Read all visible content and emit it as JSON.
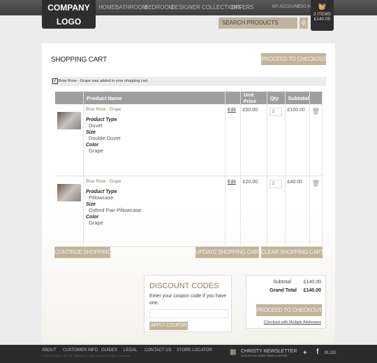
{
  "header": {
    "logo_line1": "COMPANY",
    "logo_line2": "LOGO",
    "nav": [
      "HOME",
      "BATHROOM",
      "BEDROOM",
      "DESIGNER COLLECTIONS",
      "OFFERS"
    ],
    "my_account": "MY ACCOUNT",
    "log_in": "LOG IN",
    "cart_items": "2 ITEMS",
    "cart_total": "£140.00",
    "search_placeholder": "SEARCH PRODUCTS"
  },
  "cart": {
    "title": "SHOPPING CART",
    "proceed": "PROCEED TO CHECKOUT",
    "message": "Briar Rose - Grape was added to your shopping cart.",
    "columns": [
      "",
      "Product Name",
      "",
      "Unit Price",
      "Qty",
      "Subtotal",
      ""
    ],
    "rows": [
      {
        "name": "Briar Rose - Grape",
        "edit": "Edit",
        "price": "£50.00",
        "qty": "2",
        "subtotal": "£100.00",
        "options": [
          {
            "label": "Product Type",
            "value": "Duvet"
          },
          {
            "label": "Size",
            "value": "Double Duvet"
          },
          {
            "label": "Color",
            "value": "Grape"
          }
        ]
      },
      {
        "name": "Briar Rose - Grape",
        "edit": "Edit",
        "price": "£20.00",
        "qty": "2",
        "subtotal": "£40.00",
        "options": [
          {
            "label": "Product Type",
            "value": "Pillowcase"
          },
          {
            "label": "Size",
            "value": "Oxford Pair Pillowcase"
          },
          {
            "label": "Color",
            "value": "Grape"
          }
        ]
      }
    ],
    "continue": "CONTINUE SHOPPING",
    "update": "UPDATE SHOPPING CART",
    "clear": "CLEAR SHOPPING CART"
  },
  "discount": {
    "title": "DISCOUNT CODES",
    "text": "Enter your coupon code if you have one.",
    "apply": "APPLY COUPON"
  },
  "totals": {
    "subtotal_label": "Subtotal",
    "subtotal": "£140.00",
    "grand_label": "Grand Total",
    "grand": "£140.00",
    "proceed": "PROCEED TO CHECKOUT",
    "multi": "Checkout with Multiple Addresses"
  },
  "footer": {
    "links": [
      "ABOUT",
      "CUSTOMER INFO",
      "GUIDES",
      "LEGAL",
      "CONTACT US",
      "STORE LOCATOR"
    ],
    "copyright": "© 2013 Welspun UK Ltd Trading as Christy UK Ltd. All Rights Reserved",
    "newsletter": "CHRISTY NEWSLETTER",
    "newsletter_sub": "SIGN UP FOR LATEST NEWS & OFFERS",
    "blog": "BLOG"
  },
  "colors": {
    "accent": "#c2b49a",
    "dark": "#2e2e2e",
    "table_header": "#9e9e9e"
  }
}
